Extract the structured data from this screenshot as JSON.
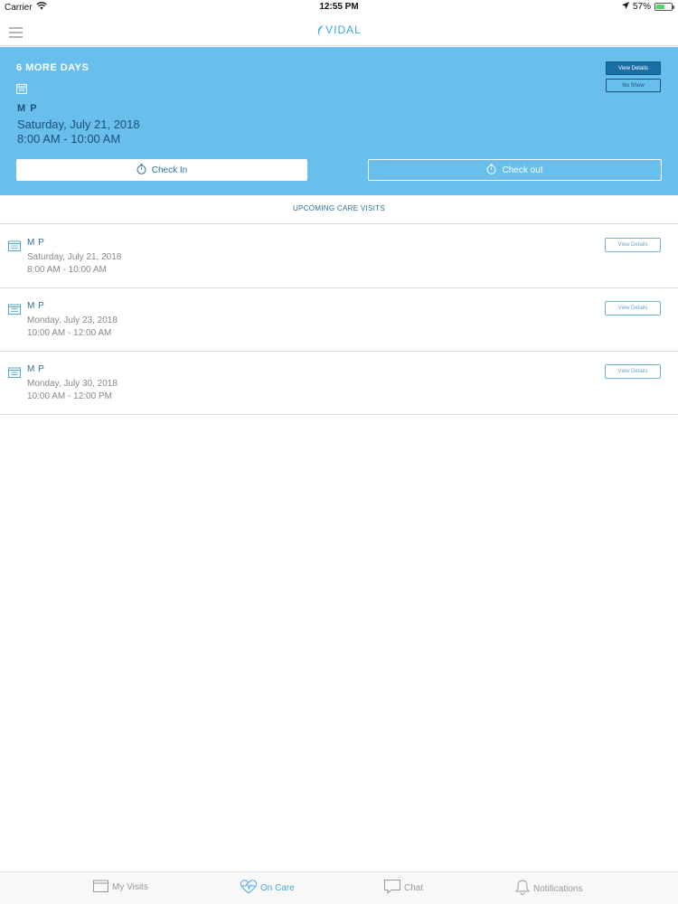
{
  "status_bar": {
    "carrier": "Carrier",
    "time": "12:55 PM",
    "battery": "57%",
    "battery_level": 0.57
  },
  "nav": {
    "logo": "VIDAL"
  },
  "current_visit": {
    "countdown": "6 MORE DAYS",
    "name": "M P",
    "date": "Saturday, July 21, 2018",
    "time": "8:00 AM - 10:00 AM",
    "view_details_label": "View Details",
    "no_show_label": "No Show",
    "check_in_label": "Check In",
    "check_out_label": "Check out"
  },
  "upcoming": {
    "title": "UPCOMING CARE VISITS",
    "visits": [
      {
        "name": "M P",
        "date": "Saturday, July 21, 2018",
        "time": "8:00 AM - 10:00 AM",
        "button": "View Details"
      },
      {
        "name": "M P",
        "date": "Monday, July 23, 2018",
        "time": "10:00 AM - 12:00 AM",
        "button": "View Details"
      },
      {
        "name": "M P",
        "date": "Monday, July 30, 2018",
        "time": "10:00 AM - 12:00 PM",
        "button": "View Details"
      }
    ]
  },
  "tabs": [
    {
      "label": "My Visits",
      "icon": "calendar-icon",
      "active": false
    },
    {
      "label": "On Care",
      "icon": "heart-pulse-icon",
      "active": true
    },
    {
      "label": "Chat",
      "icon": "chat-bubble-icon",
      "active": false
    },
    {
      "label": "Notifications",
      "icon": "bell-icon",
      "active": false
    }
  ],
  "colors": {
    "hero_background": "#68bfec",
    "accent": "#2d6f9b",
    "active_tab": "#4aa9dd"
  }
}
